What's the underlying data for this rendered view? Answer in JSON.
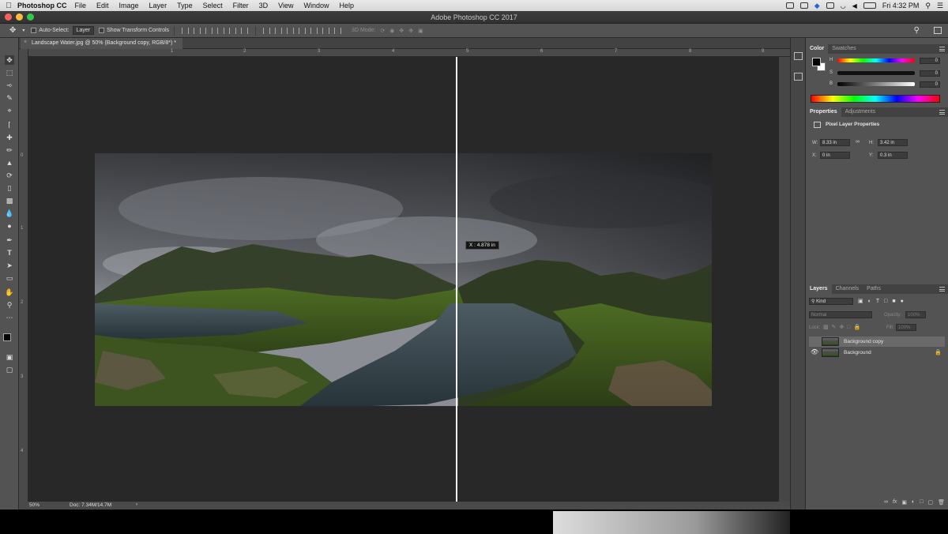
{
  "menubar": {
    "app_name": "Photoshop CC",
    "items": [
      "File",
      "Edit",
      "Image",
      "Layer",
      "Type",
      "Select",
      "Filter",
      "3D",
      "View",
      "Window",
      "Help"
    ],
    "clock": "Fri 4:32 PM"
  },
  "window": {
    "title": "Adobe Photoshop CC 2017"
  },
  "options_bar": {
    "auto_select_label": "Auto-Select:",
    "auto_select_target": "Layer",
    "transform_controls_label": "Show Transform Controls",
    "mode_3d_label": "3D Mode:"
  },
  "document": {
    "tab_label": "Landscape Water.jpg @ 50% (Background copy, RGB/8*) *",
    "ruler_top": [
      "1",
      "2",
      "3",
      "4",
      "5",
      "6",
      "7",
      "8",
      "9"
    ],
    "ruler_left": [
      "0",
      "1",
      "2",
      "3",
      "4"
    ],
    "zoom": "50%",
    "doc_size": "Doc: 7.34M/14.7M",
    "guide_readout": "X : 4.878 in"
  },
  "color_panel": {
    "tabs": [
      "Color",
      "Swatches"
    ],
    "sliders": [
      {
        "label": "H",
        "value": "0"
      },
      {
        "label": "S",
        "value": "0"
      },
      {
        "label": "B",
        "value": "0"
      }
    ]
  },
  "properties_panel": {
    "tabs": [
      "Properties",
      "Adjustments"
    ],
    "heading": "Pixel Layer Properties",
    "w_label": "W:",
    "w_value": "8.33 in",
    "h_label": "H:",
    "h_value": "3.42 in",
    "x_label": "X:",
    "x_value": "0 in",
    "y_label": "Y:",
    "y_value": "0.3 in"
  },
  "layers_panel": {
    "tabs": [
      "Layers",
      "Channels",
      "Paths"
    ],
    "filter_label": "Kind",
    "blend_mode": "Normal",
    "opacity_label": "Opacity:",
    "opacity_value": "100%",
    "lock_label": "Lock:",
    "fill_label": "Fill:",
    "fill_value": "100%",
    "layers": [
      {
        "name": "Background copy",
        "selected": true
      },
      {
        "name": "Background",
        "selected": false
      }
    ]
  },
  "colors": {
    "accent_selection": "#6a6a6a",
    "panel_bg": "#535353",
    "pasteboard": "#282828"
  }
}
